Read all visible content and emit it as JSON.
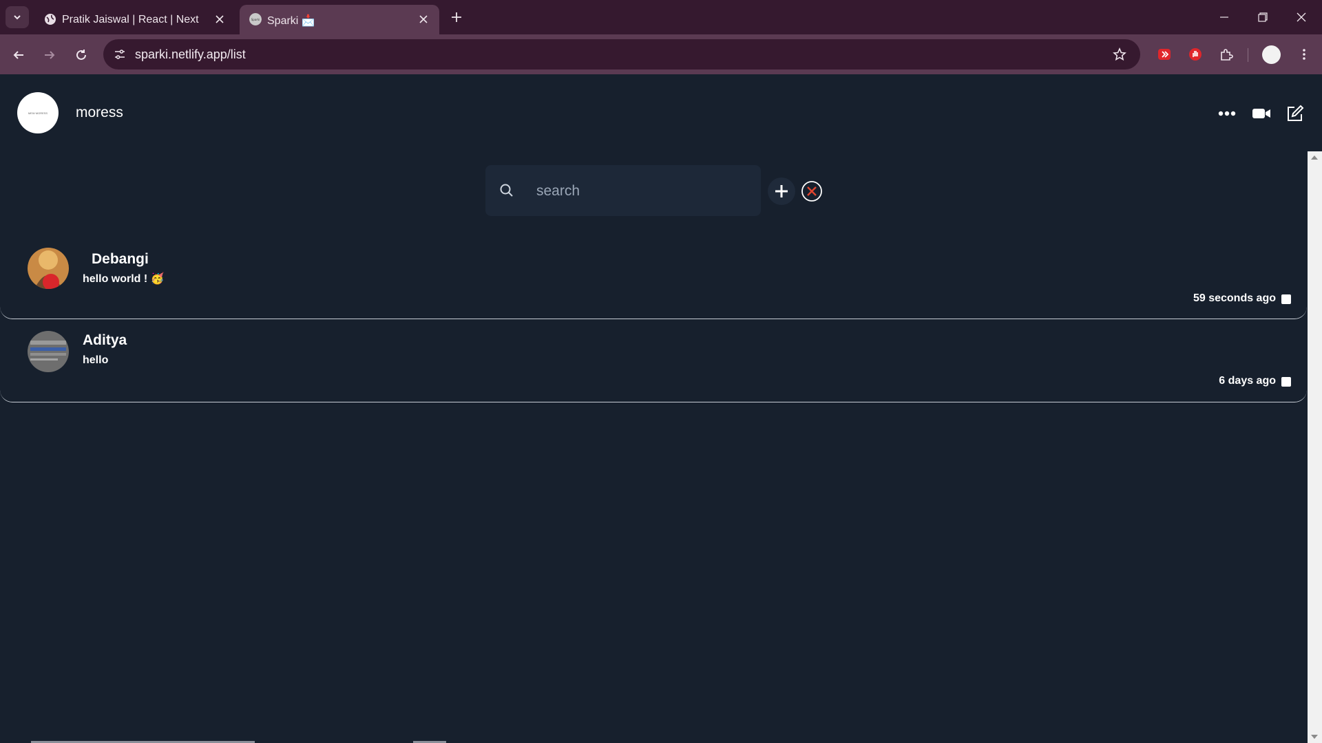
{
  "browser": {
    "tabs": [
      {
        "title": "Pratik Jaiswal | React | Next",
        "active": false,
        "icon": "globe-icon"
      },
      {
        "title": "Sparki 📩",
        "active": true,
        "icon": "sparki-favicon"
      }
    ],
    "url": "sparki.netlify.app/list",
    "extensions": [
      "video-downloader-icon",
      "hand-stop-icon",
      "puzzle-icon"
    ]
  },
  "header": {
    "username": "moress",
    "avatar_text": "MEW MORESS"
  },
  "search": {
    "placeholder": "search",
    "value": ""
  },
  "chats": [
    {
      "name": "Debangi",
      "message": "hello world ! 🥳",
      "time": "59 seconds ago"
    },
    {
      "name": "Aditya",
      "message": "hello",
      "time": "6 days ago"
    }
  ],
  "colors": {
    "background": "#17202d",
    "tabbar": "#35192f",
    "toolbar": "#5b3a52",
    "clear_accent": "#e0452f"
  }
}
